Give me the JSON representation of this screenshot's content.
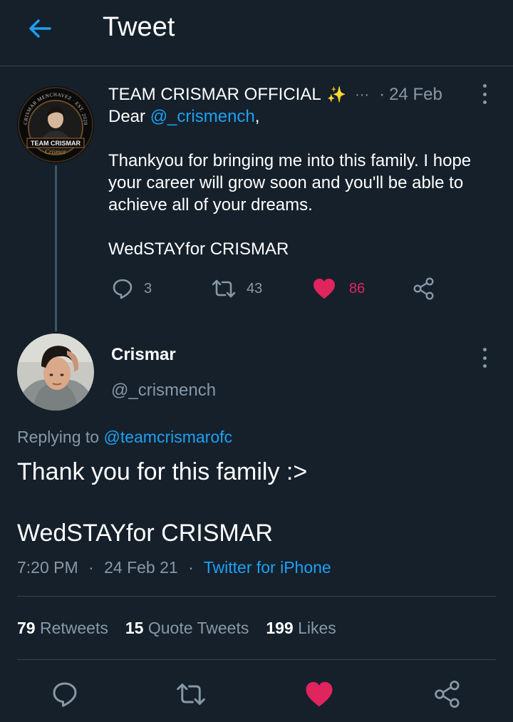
{
  "header": {
    "title": "Tweet",
    "back_icon": "arrow-left-icon"
  },
  "parent_tweet": {
    "author_name": "TEAM CRISMAR OFFICIAL",
    "emoji": "✨",
    "name_ellipsis": "···",
    "date_separator": "·",
    "date": "24 Feb",
    "greeting_prefix": "Dear ",
    "mention": "@_crismench",
    "greeting_suffix": ",",
    "body": "Thankyou for bringing me into this family. I hope your career will grow soon and you'll be able to achieve all of your dreams.",
    "hashtag_line": "WedSTAYfor CRISMAR",
    "avatar_text_top": "CRISMAR MENCHAVEZ · EST. 2020",
    "avatar_label": "TEAM CRISMAR",
    "avatar_signature": "Crismar",
    "reply_count": "3",
    "retweet_count": "43",
    "like_count": "86"
  },
  "main_tweet": {
    "author_name": "Crismar",
    "handle": "@_crismench",
    "replying_label": "Replying to ",
    "replying_to": "@teamcrismarofc",
    "text_line1": "Thank you for this family :>",
    "text_line2": "WedSTAYfor CRISMAR",
    "time": "7:20 PM",
    "meta_separator": "·",
    "date": "24 Feb 21",
    "meta_separator2": "·",
    "source": "Twitter for iPhone"
  },
  "stats": {
    "retweets_count": "79",
    "retweets_label": "Retweets",
    "quotes_count": "15",
    "quotes_label": "Quote Tweets",
    "likes_count": "199",
    "likes_label": "Likes"
  },
  "colors": {
    "background": "#15202b",
    "accent": "#1da1f2",
    "like": "#e0245e",
    "secondary_text": "#8899a6",
    "divider": "#38444d"
  }
}
